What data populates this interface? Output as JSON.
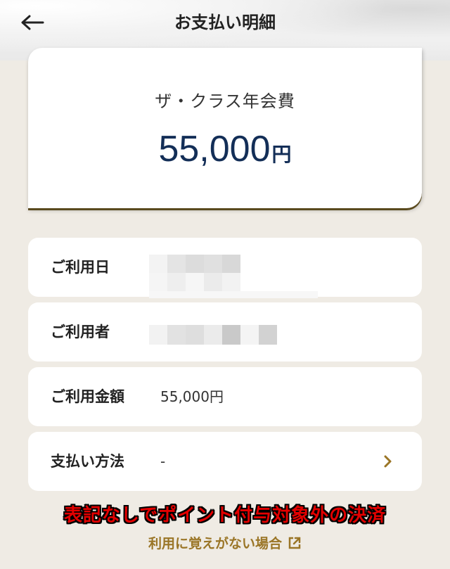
{
  "header": {
    "title": "お支払い明細"
  },
  "summary": {
    "label": "ザ・クラス年会費",
    "amount": "55,000",
    "unit": "円"
  },
  "rows": [
    {
      "label": "ご利用日",
      "value": ""
    },
    {
      "label": "ご利用者",
      "value": ""
    },
    {
      "label": "ご利用金額",
      "value": "55,000円"
    },
    {
      "label": "支払い方法",
      "value": "-"
    }
  ],
  "annotation": "表記なしでポイント付与対象外の決済",
  "help_link": {
    "label": "利用に覚えがない場合"
  },
  "icons": {
    "back": "arrow-left-icon",
    "chevron": "chevron-right-icon",
    "external": "external-link-icon"
  },
  "colors": {
    "amount": "#132e57",
    "accent": "#9a7526",
    "background": "#efebe4",
    "annotation": "#e30000"
  }
}
